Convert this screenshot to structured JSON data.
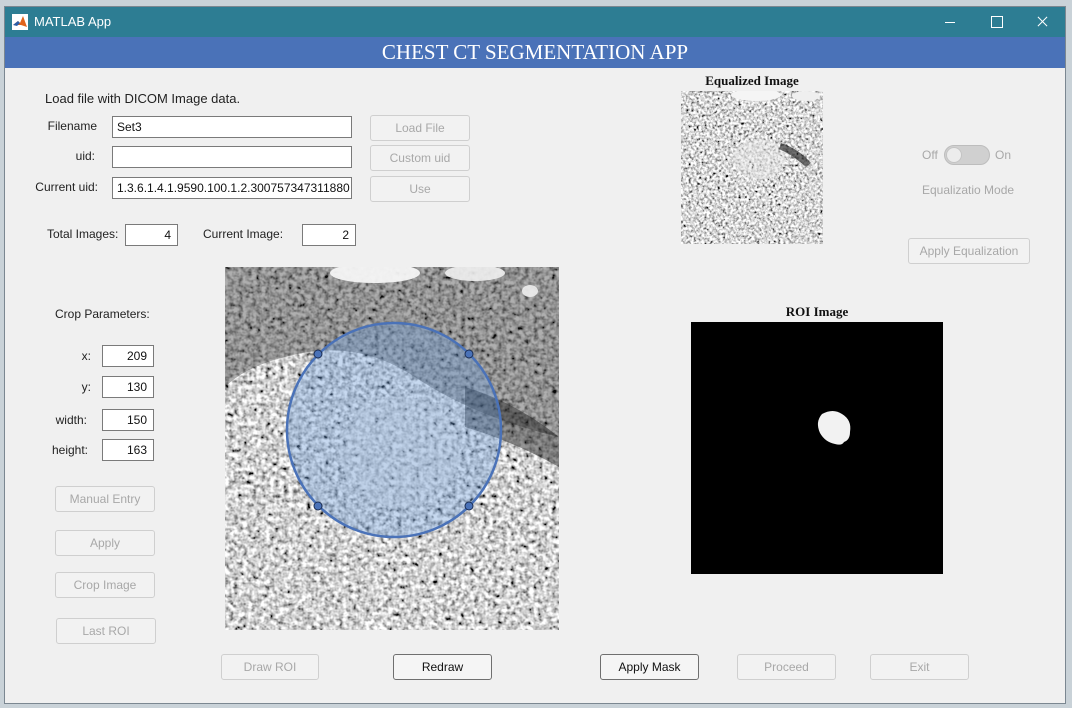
{
  "window": {
    "title": "MATLAB App",
    "title_bar_color": "#2d7d93"
  },
  "header": {
    "title": "CHEST CT SEGMENTATION APP",
    "banner_color": "#4a72b8"
  },
  "load_section": {
    "heading": "Load file with DICOM Image data.",
    "filename_label": "Filename",
    "filename_value": "Set3",
    "uid_label": "uid:",
    "uid_value": "",
    "current_uid_label": "Current uid:",
    "current_uid_value": "1.3.6.1.4.1.9590.100.1.2.300757347311880",
    "load_file_button": "Load File",
    "custom_uid_button": "Custom uid",
    "use_button": "Use"
  },
  "counts": {
    "total_images_label": "Total Images:",
    "total_images_value": "4",
    "current_image_label": "Current Image:",
    "current_image_value": "2"
  },
  "crop": {
    "heading": "Crop Parameters:",
    "x_label": "x:",
    "x_value": "209",
    "y_label": "y:",
    "y_value": "130",
    "width_label": "width:",
    "width_value": "150",
    "height_label": "height:",
    "height_value": "163",
    "manual_entry_button": "Manual Entry",
    "apply_button": "Apply",
    "crop_image_button": "Crop Image",
    "last_roi_button": "Last ROI"
  },
  "equalization": {
    "panel_title": "Equalized Image",
    "toggle_off_label": "Off",
    "toggle_on_label": "On",
    "toggle_state": "off",
    "mode_label": "Equalizatio Mode",
    "apply_button": "Apply Equalization"
  },
  "roi": {
    "panel_title": "ROI Image",
    "roi_color": "#4a72b8"
  },
  "bottom_buttons": {
    "draw_roi": "Draw ROI",
    "redraw": "Redraw",
    "apply_mask": "Apply Mask",
    "proceed": "Proceed",
    "exit": "Exit"
  },
  "icons": {
    "app_icon": "matlab-logo-icon",
    "minimize": "minimize-icon",
    "maximize": "maximize-icon",
    "close": "close-icon"
  }
}
